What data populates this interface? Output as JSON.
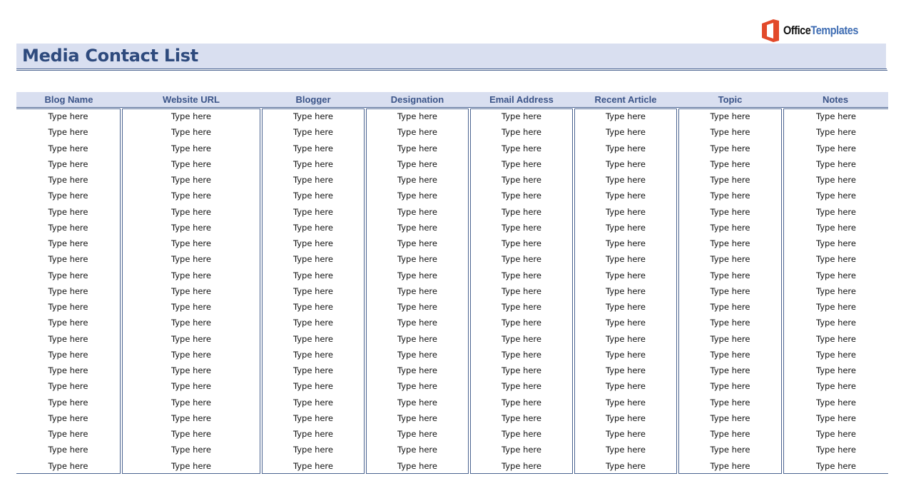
{
  "logo": {
    "icon": "office-logo-icon",
    "brand_part1": "Office",
    "brand_part2": "Templates",
    "colors": {
      "mark": "#e2492a",
      "part1": "#111111",
      "part2": "#3f6db3"
    }
  },
  "document": {
    "title": "Media Contact List",
    "title_color": "#2e4a7d",
    "band_color": "#d9dff0"
  },
  "table": {
    "columns": [
      "Blog Name",
      "Website URL",
      "Blogger",
      "Designation",
      "Email Address",
      "Recent Article",
      "Topic",
      "Notes"
    ],
    "placeholder": "Type here",
    "row_count": 23,
    "rows": [
      [
        "Type here",
        "Type here",
        "Type here",
        "Type here",
        "Type here",
        "Type here",
        "Type here",
        "Type here"
      ],
      [
        "Type here",
        "Type here",
        "Type here",
        "Type here",
        "Type here",
        "Type here",
        "Type here",
        "Type here"
      ],
      [
        "Type here",
        "Type here",
        "Type here",
        "Type here",
        "Type here",
        "Type here",
        "Type here",
        "Type here"
      ],
      [
        "Type here",
        "Type here",
        "Type here",
        "Type here",
        "Type here",
        "Type here",
        "Type here",
        "Type here"
      ],
      [
        "Type here",
        "Type here",
        "Type here",
        "Type here",
        "Type here",
        "Type here",
        "Type here",
        "Type here"
      ],
      [
        "Type here",
        "Type here",
        "Type here",
        "Type here",
        "Type here",
        "Type here",
        "Type here",
        "Type here"
      ],
      [
        "Type here",
        "Type here",
        "Type here",
        "Type here",
        "Type here",
        "Type here",
        "Type here",
        "Type here"
      ],
      [
        "Type here",
        "Type here",
        "Type here",
        "Type here",
        "Type here",
        "Type here",
        "Type here",
        "Type here"
      ],
      [
        "Type here",
        "Type here",
        "Type here",
        "Type here",
        "Type here",
        "Type here",
        "Type here",
        "Type here"
      ],
      [
        "Type here",
        "Type here",
        "Type here",
        "Type here",
        "Type here",
        "Type here",
        "Type here",
        "Type here"
      ],
      [
        "Type here",
        "Type here",
        "Type here",
        "Type here",
        "Type here",
        "Type here",
        "Type here",
        "Type here"
      ],
      [
        "Type here",
        "Type here",
        "Type here",
        "Type here",
        "Type here",
        "Type here",
        "Type here",
        "Type here"
      ],
      [
        "Type here",
        "Type here",
        "Type here",
        "Type here",
        "Type here",
        "Type here",
        "Type here",
        "Type here"
      ],
      [
        "Type here",
        "Type here",
        "Type here",
        "Type here",
        "Type here",
        "Type here",
        "Type here",
        "Type here"
      ],
      [
        "Type here",
        "Type here",
        "Type here",
        "Type here",
        "Type here",
        "Type here",
        "Type here",
        "Type here"
      ],
      [
        "Type here",
        "Type here",
        "Type here",
        "Type here",
        "Type here",
        "Type here",
        "Type here",
        "Type here"
      ],
      [
        "Type here",
        "Type here",
        "Type here",
        "Type here",
        "Type here",
        "Type here",
        "Type here",
        "Type here"
      ],
      [
        "Type here",
        "Type here",
        "Type here",
        "Type here",
        "Type here",
        "Type here",
        "Type here",
        "Type here"
      ],
      [
        "Type here",
        "Type here",
        "Type here",
        "Type here",
        "Type here",
        "Type here",
        "Type here",
        "Type here"
      ],
      [
        "Type here",
        "Type here",
        "Type here",
        "Type here",
        "Type here",
        "Type here",
        "Type here",
        "Type here"
      ],
      [
        "Type here",
        "Type here",
        "Type here",
        "Type here",
        "Type here",
        "Type here",
        "Type here",
        "Type here"
      ],
      [
        "Type here",
        "Type here",
        "Type here",
        "Type here",
        "Type here",
        "Type here",
        "Type here",
        "Type here"
      ],
      [
        "Type here",
        "Type here",
        "Type here",
        "Type here",
        "Type here",
        "Type here",
        "Type here",
        "Type here"
      ]
    ]
  }
}
